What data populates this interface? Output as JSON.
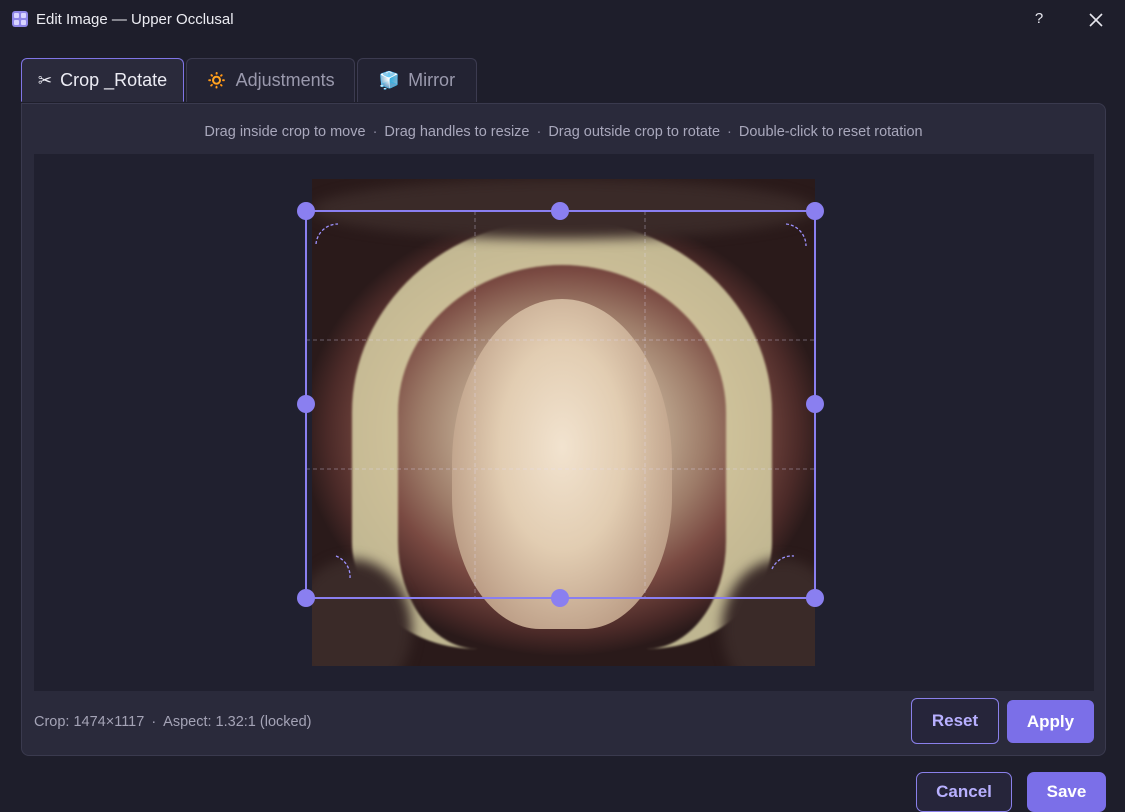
{
  "window": {
    "title": "Edit Image — Upper Occlusal",
    "help_label": "?",
    "icons": {
      "app": "grid-app-icon",
      "close": "close-icon"
    }
  },
  "tabs": [
    {
      "label": "Crop _Rotate",
      "icon": "✂",
      "active": true
    },
    {
      "label": "Adjustments",
      "icon": "🔅",
      "active": false
    },
    {
      "label": "Mirror",
      "icon": "🧊",
      "active": false
    }
  ],
  "hint": {
    "items": [
      "Drag inside crop to move",
      "Drag handles to resize",
      "Drag outside crop to rotate",
      "Double-click to reset rotation"
    ],
    "separator": "·"
  },
  "status": {
    "crop": "Crop: 1474×1117",
    "separator": "·",
    "aspect": "Aspect: 1.32:1 (locked)"
  },
  "buttons": {
    "reset": "Reset",
    "apply": "Apply",
    "cancel": "Cancel",
    "save": "Save"
  },
  "colors": {
    "accent": "#7b6fe8",
    "crop_frame": "#8a7ff0",
    "background": "#1e1e2b"
  }
}
